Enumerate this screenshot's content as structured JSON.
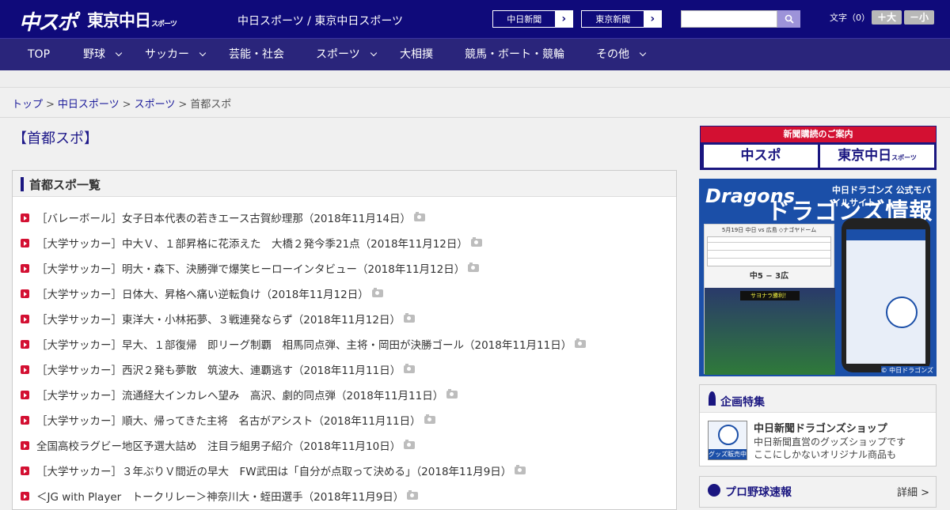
{
  "header": {
    "logo_main": "中スポ",
    "logo_tokyo": "東京中日",
    "logo_tokyo_small": "スポーツ",
    "site_name": "中日スポーツ / 東京中日スポーツ",
    "paper_links": [
      {
        "label": "中日新聞"
      },
      {
        "label": "東京新聞"
      }
    ],
    "search": {
      "value": "",
      "placeholder": ""
    },
    "font_size_label": "文字（0）",
    "font_larger": "＋大",
    "font_smaller": "－小",
    "colors": {
      "primary": "#0f0a7a",
      "nav": "#2a257b",
      "accent_red": "#d31032"
    }
  },
  "nav": {
    "items": [
      {
        "label": "TOP",
        "dropdown": false
      },
      {
        "label": "野球",
        "dropdown": true
      },
      {
        "label": "サッカー",
        "dropdown": true
      },
      {
        "label": "芸能・社会",
        "dropdown": false
      },
      {
        "label": "スポーツ",
        "dropdown": true
      },
      {
        "label": "大相撲",
        "dropdown": false
      },
      {
        "label": "競馬・ボート・競輪",
        "dropdown": false
      },
      {
        "label": "その他",
        "dropdown": true
      }
    ]
  },
  "breadcrumb": {
    "items": [
      "トップ",
      "中日スポーツ",
      "スポーツ"
    ],
    "current": "首都スポ",
    "separator": ">"
  },
  "page": {
    "heading": "【首都スポ】"
  },
  "list": {
    "title": "首都スポ一覧",
    "articles": [
      {
        "text": "［バレーボール］女子日本代表の若きエース古賀紗理那（2018年11月14日）",
        "has_photo": true
      },
      {
        "text": "［大学サッカー］中大Ｖ、１部昇格に花添えた　大橋２発今季21点（2018年11月12日）",
        "has_photo": true
      },
      {
        "text": "［大学サッカー］明大・森下、決勝弾で爆笑ヒーローインタビュー（2018年11月12日）",
        "has_photo": true
      },
      {
        "text": "［大学サッカー］日体大、昇格へ痛い逆転負け（2018年11月12日）",
        "has_photo": true
      },
      {
        "text": "［大学サッカー］東洋大・小林拓夢、３戦連発ならず（2018年11月12日）",
        "has_photo": true
      },
      {
        "text": "［大学サッカー］早大、１部復帰　即リーグ制覇　相馬同点弾、主将・岡田が決勝ゴール（2018年11月11日）",
        "has_photo": true
      },
      {
        "text": "［大学サッカー］西沢２発も夢散　筑波大、連覇逃す（2018年11月11日）",
        "has_photo": true
      },
      {
        "text": "［大学サッカー］流通経大インカレへ望み　高沢、劇的同点弾（2018年11月11日）",
        "has_photo": true
      },
      {
        "text": "［大学サッカー］順大、帰ってきた主将　名古がアシスト（2018年11月11日）",
        "has_photo": true
      },
      {
        "text": "全国高校ラグビー地区予選大詰め　注目ラ組男子紹介（2018年11月10日）",
        "has_photo": true
      },
      {
        "text": "［大学サッカー］３年ぶりＶ間近の早大　FW武田は「自分が点取って決める」（2018年11月9日）",
        "has_photo": true
      },
      {
        "text": "＜JG with Player　トークリレー＞神奈川大・蛭田選手（2018年11月9日）",
        "has_photo": true
      }
    ]
  },
  "sidebar": {
    "subscribe": {
      "title": "新聞購読のご案内",
      "left": "中スポ",
      "right": "東京中日",
      "right_small": "スポーツ"
    },
    "dragons_banner": {
      "logo": "Dragons",
      "subtitle": "中日ドラゴンズ 公式モバイルサイト",
      "title": "ドラゴンズ情報",
      "game_date": "5月19日 中日 vs 広島 ◇ナゴヤドーム",
      "score": "中5 − 3広",
      "sayonara": "サヨナラ勝利！",
      "footer": "© 中日ドラゴンズ"
    },
    "feature": {
      "heading": "企画特集",
      "item_title": "中日新聞ドラゴンズショップ",
      "item_desc_1": "中日新聞直営のグッズショップです",
      "item_desc_2": "ここにしかないオリジナル商品も",
      "thumb_label": "グッズ販売中"
    },
    "baseball": {
      "heading": "プロ野球速報",
      "more": "詳細 >"
    }
  }
}
